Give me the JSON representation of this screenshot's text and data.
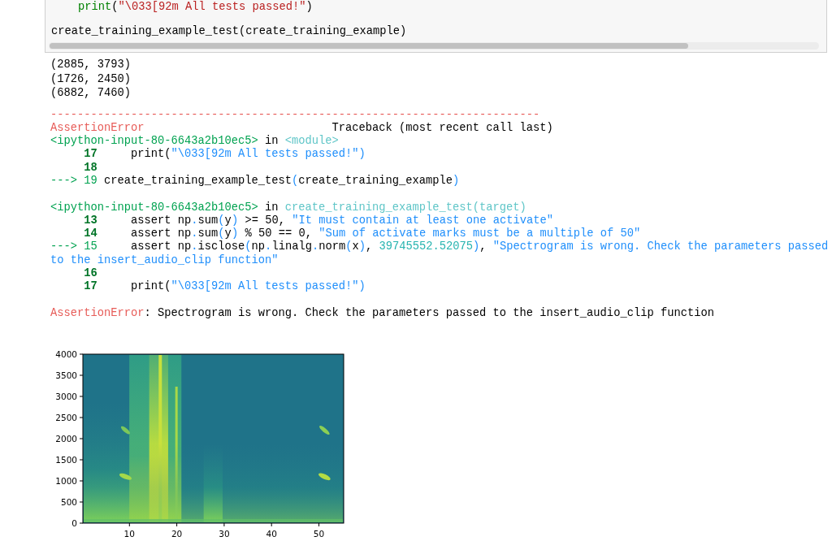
{
  "code_cell": {
    "blocks": [
      [
        {
          "tokens": [
            {
              "kind": "builtin",
              "text": "    print"
            },
            {
              "kind": "plain",
              "text": "("
            },
            {
              "kind": "string",
              "text": "\"\\033[92m All tests passed!\""
            },
            {
              "kind": "plain",
              "text": ")"
            }
          ]
        }
      ],
      [
        {
          "tokens": [
            {
              "kind": "plain",
              "text": "create_training_example_test(create_training_example)"
            }
          ]
        }
      ]
    ]
  },
  "output": {
    "stream": [
      "(2885, 3793)",
      "(1726, 2450)",
      "(6882, 7460)"
    ],
    "traceback": [
      [
        {
          "tokens": [
            {
              "kind": "error",
              "text": "-------------------------------------------------------------------------"
            }
          ]
        },
        {
          "tokens": [
            {
              "kind": "error",
              "text": "AssertionError"
            },
            {
              "kind": "plain",
              "text": "                            Traceback (most recent call last)"
            }
          ]
        },
        {
          "tokens": [
            {
              "kind": "frame",
              "text": "<ipython-input-80-6643a2b10ec5>"
            },
            {
              "kind": "plain",
              "text": " in "
            },
            {
              "kind": "link",
              "text": "<module>"
            }
          ]
        },
        {
          "tokens": [
            {
              "kind": "lineno",
              "text": "     17"
            },
            {
              "kind": "plain",
              "text": "     print("
            },
            {
              "kind": "tstring",
              "text": "\"\\033[92m All tests passed!\""
            },
            {
              "kind": "punct",
              "text": ")"
            }
          ]
        },
        {
          "tokens": [
            {
              "kind": "lineno",
              "text": "     18"
            }
          ]
        },
        {
          "tokens": [
            {
              "kind": "arrow",
              "text": "---> 19"
            },
            {
              "kind": "plain",
              "text": " create_training_example_test"
            },
            {
              "kind": "punct",
              "text": "("
            },
            {
              "kind": "plain",
              "text": "create_training_example"
            },
            {
              "kind": "punct",
              "text": ")"
            }
          ]
        }
      ],
      [
        {
          "tokens": [
            {
              "kind": "frame",
              "text": "<ipython-input-80-6643a2b10ec5>"
            },
            {
              "kind": "plain",
              "text": " in "
            },
            {
              "kind": "link",
              "text": "create_training_example_test(target)"
            }
          ]
        },
        {
          "tokens": [
            {
              "kind": "lineno",
              "text": "     13"
            },
            {
              "kind": "plain",
              "text": "     assert np"
            },
            {
              "kind": "punct",
              "text": "."
            },
            {
              "kind": "plain",
              "text": "sum"
            },
            {
              "kind": "punct",
              "text": "("
            },
            {
              "kind": "plain",
              "text": "y"
            },
            {
              "kind": "punct",
              "text": ")"
            },
            {
              "kind": "plain",
              "text": " >= 50, "
            },
            {
              "kind": "tstring",
              "text": "\"It must contain at least one activate\""
            }
          ]
        },
        {
          "tokens": [
            {
              "kind": "lineno",
              "text": "     14"
            },
            {
              "kind": "plain",
              "text": "     assert np"
            },
            {
              "kind": "punct",
              "text": "."
            },
            {
              "kind": "plain",
              "text": "sum"
            },
            {
              "kind": "punct",
              "text": "("
            },
            {
              "kind": "plain",
              "text": "y"
            },
            {
              "kind": "punct",
              "text": ")"
            },
            {
              "kind": "plain",
              "text": " % 50 == 0, "
            },
            {
              "kind": "tstring",
              "text": "\"Sum of activate marks must be a multiple of 50\""
            }
          ]
        },
        {
          "tokens": [
            {
              "kind": "arrow",
              "text": "---> 15"
            },
            {
              "kind": "plain",
              "text": "     assert np"
            },
            {
              "kind": "punct",
              "text": "."
            },
            {
              "kind": "plain",
              "text": "isclose"
            },
            {
              "kind": "punct",
              "text": "("
            },
            {
              "kind": "plain",
              "text": "np"
            },
            {
              "kind": "punct",
              "text": "."
            },
            {
              "kind": "plain",
              "text": "linalg"
            },
            {
              "kind": "punct",
              "text": "."
            },
            {
              "kind": "plain",
              "text": "norm"
            },
            {
              "kind": "punct",
              "text": "("
            },
            {
              "kind": "plain",
              "text": "x"
            },
            {
              "kind": "punct",
              "text": ")"
            },
            {
              "kind": "plain",
              "text": ", "
            },
            {
              "kind": "tnum",
              "text": "39745552.52075"
            },
            {
              "kind": "punct",
              "text": ")"
            },
            {
              "kind": "plain",
              "text": ", "
            },
            {
              "kind": "tstring",
              "text": "\"Spectrogram is wrong. Check the parameters passed to the insert_audio_clip function\""
            }
          ]
        },
        {
          "tokens": [
            {
              "kind": "lineno",
              "text": "     16"
            }
          ]
        },
        {
          "tokens": [
            {
              "kind": "lineno",
              "text": "     17"
            },
            {
              "kind": "plain",
              "text": "     print("
            },
            {
              "kind": "tstring",
              "text": "\"\\033[92m All tests passed!\""
            },
            {
              "kind": "punct",
              "text": ")"
            }
          ]
        }
      ],
      [
        {
          "tokens": [
            {
              "kind": "error",
              "text": "AssertionError"
            },
            {
              "kind": "plain",
              "text": ": Spectrogram is wrong. Check the parameters passed to the insert_audio_clip function"
            }
          ]
        }
      ]
    ]
  },
  "spectrogram": {
    "y_ticks": [
      "4000",
      "3500",
      "3000",
      "2500",
      "2000",
      "1500",
      "1000",
      "500",
      "0"
    ],
    "x_ticks": [
      "10",
      "20",
      "30",
      "40",
      "50"
    ]
  }
}
